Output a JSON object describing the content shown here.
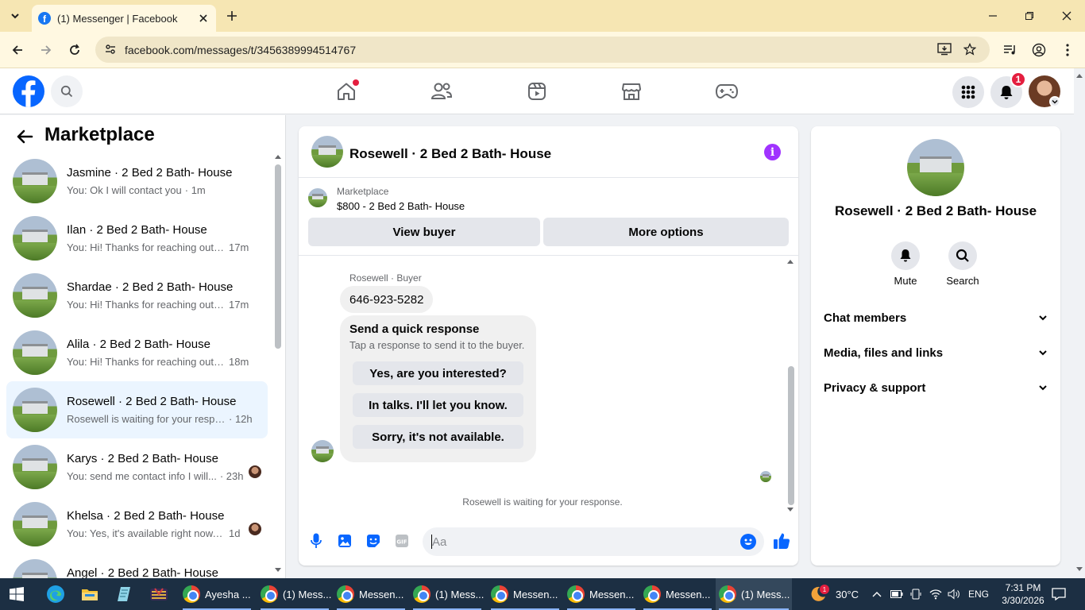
{
  "browser": {
    "tab_title": "(1) Messenger | Facebook",
    "url": "facebook.com/messages/t/3456389994514767"
  },
  "header": {
    "notification_count": "1"
  },
  "sidebar": {
    "title": "Marketplace",
    "conversations": [
      {
        "name": "Jasmine · 2 Bed 2 Bath- House",
        "snippet": "You: Ok I will contact you",
        "time": "· 1m"
      },
      {
        "name": "Ilan · 2 Bed 2 Bath- House",
        "snippet": "You: Hi! Thanks for reaching out. ...",
        "time": "17m"
      },
      {
        "name": "Shardae · 2 Bed 2 Bath- House",
        "snippet": "You: Hi! Thanks for reaching out. ...",
        "time": "17m"
      },
      {
        "name": "Alila · 2 Bed 2 Bath- House",
        "snippet": "You: Hi! Thanks for reaching out. ...",
        "time": "18m"
      },
      {
        "name": "Rosewell · 2 Bed 2 Bath- House",
        "snippet": "Rosewell is waiting for your respo...",
        "time": "· 12h"
      },
      {
        "name": "Karys · 2 Bed 2 Bath- House",
        "snippet": "You: send me contact info I will...",
        "time": "· 23h"
      },
      {
        "name": "Khelsa · 2 Bed 2 Bath- House",
        "snippet": "You: Yes, it's available right now. ...",
        "time": "1d"
      },
      {
        "name": "Angel · 2 Bed 2 Bath- House",
        "snippet": "",
        "time": ""
      }
    ]
  },
  "chat": {
    "title": "Rosewell · 2 Bed 2 Bath- House",
    "marketplace_label": "Marketplace",
    "listing": "$800 - 2 Bed 2 Bath- House",
    "view_buyer": "View buyer",
    "more_options": "More options",
    "sender": "Rosewell · Buyer",
    "phone_message": "646-923-5282",
    "quick_title": "Send a quick response",
    "quick_sub": "Tap a response to send it to the buyer.",
    "quick_responses": [
      "Yes, are you interested?",
      "In talks. I'll let you know.",
      "Sorry, it's not available."
    ],
    "waiting_text": "Rosewell is waiting for your response.",
    "composer_placeholder": "Aa"
  },
  "right_panel": {
    "name": "Rosewell · 2 Bed 2 Bath- House",
    "mute": "Mute",
    "search": "Search",
    "sections": [
      "Chat members",
      "Media, files and links",
      "Privacy & support"
    ]
  },
  "taskbar": {
    "apps": [
      "Ayesha ...",
      "(1) Mess...",
      "Messen...",
      "(1) Mess...",
      "Messen...",
      "Messen...",
      "Messen...",
      "(1) Mess..."
    ],
    "weather_badge": "1",
    "temperature": "30°C",
    "language": "ENG",
    "time": "7:31 PM",
    "date": "3/30/2026"
  },
  "colors": {
    "fb_blue": "#0866ff",
    "info_purple": "#a033ff",
    "notification_red": "#e41e3f",
    "active_conversation": "#ebf5ff"
  }
}
